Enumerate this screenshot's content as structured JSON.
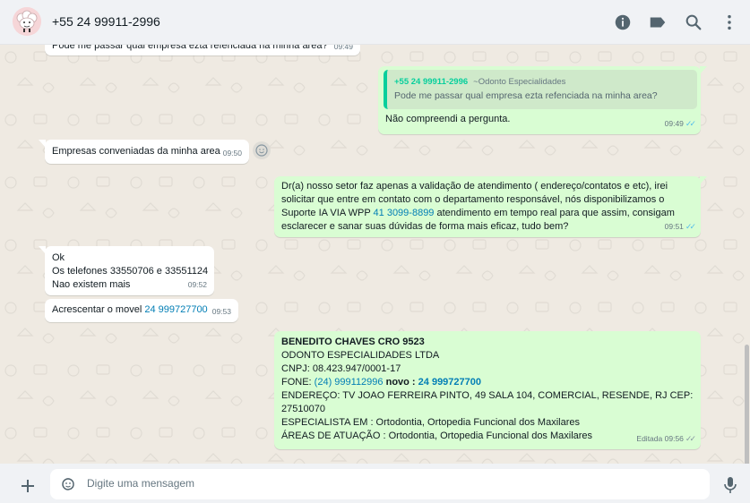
{
  "header": {
    "contact_name": "+55 24 99911-2996",
    "icons": [
      "info-icon",
      "label-icon",
      "search-icon",
      "more-vertical-icon"
    ]
  },
  "messages": {
    "m0": {
      "text": "Pode me passar qual empresa ezta  refenciada na minha area?",
      "time": "09:49"
    },
    "m1": {
      "quote_name": "+55 24 99911-2996",
      "quote_source": "~Odonto Especialidades",
      "quote_text": "Pode me passar qual empresa ezta  refenciada na minha area?",
      "text": "Não compreendi a pergunta.",
      "time": "09:49"
    },
    "m2": {
      "text": "Empresas conveniadas da minha area",
      "time": "09:50"
    },
    "m3": {
      "line1": "Dr(a) nosso setor faz apenas a validação de atendimento ( endereço/contatos e etc), irei",
      "line2": "solicitar que entre em contato com o departamento responsável, nós disponibilizamos o",
      "line3_pre": "Suporte IA VIA WPP ",
      "line3_link": "41 3099-8899",
      "line3_post": " atendimento em tempo real para que assim, consigam",
      "line4": "esclarecer e sanar suas dúvidas de forma mais eficaz, tudo bem?",
      "time": "09:51"
    },
    "m4": {
      "line1": "Ok",
      "line2": "Os telefones 33550706 e 33551124",
      "line3": "Nao existem mais",
      "time": "09:52"
    },
    "m5": {
      "text_pre": "Acrescentar o movel ",
      "link": "24 999727700",
      "time": "09:53"
    },
    "m6": {
      "line1": "BENEDITO CHAVES CRO 9523",
      "line2": "ODONTO ESPECIALIDADES LTDA",
      "line3": "CNPJ: 08.423.947/0001-17",
      "line4_pre": "FONE: ",
      "line4_link": "(24) 999112996",
      "line4_bold": " novo : ",
      "line4_link2": "24 999727700",
      "line5": "ENDEREÇO: TV JOAO FERREIRA PINTO, 49 SALA 104, COMERCIAL, RESENDE, RJ CEP:",
      "line6": "27510070",
      "line7": "ESPECIALISTA EM : Ortodontia, Ortopedia Funcional dos Maxilares",
      "line8": "ÁREAS DE ATUAÇÃO : Ortodontia, Ortopedia Funcional dos Maxilares",
      "edited": "Editada",
      "time": "09:56"
    }
  },
  "composer": {
    "placeholder": "Digite uma mensagem"
  },
  "colors": {
    "outgoing_bubble": "#d9fdd3",
    "incoming_bubble": "#ffffff",
    "chat_background": "#efeae2",
    "link": "#027eb5",
    "read_ticks": "#53bdeb"
  }
}
